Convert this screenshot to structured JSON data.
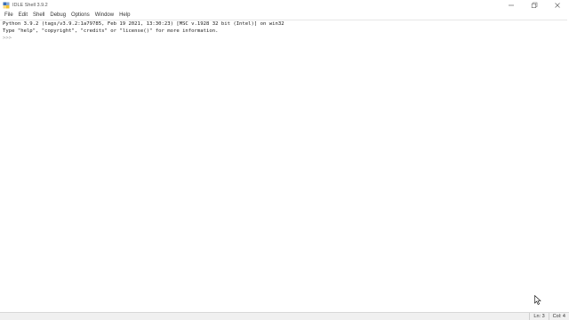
{
  "window": {
    "title": "IDLE Shell 3.9.2"
  },
  "menu": [
    "File",
    "Edit",
    "Shell",
    "Debug",
    "Options",
    "Window",
    "Help"
  ],
  "shell": {
    "lines": [
      "Python 3.9.2 (tags/v3.9.2:1a79785, Feb 19 2021, 13:30:23) [MSC v.1928 32 bit (Intel)] on win32",
      "Type \"help\", \"copyright\", \"credits\" or \"license()\" for more information."
    ],
    "prompt": ">>>"
  },
  "status": {
    "line": "Ln: 3",
    "col": "Col: 4"
  }
}
